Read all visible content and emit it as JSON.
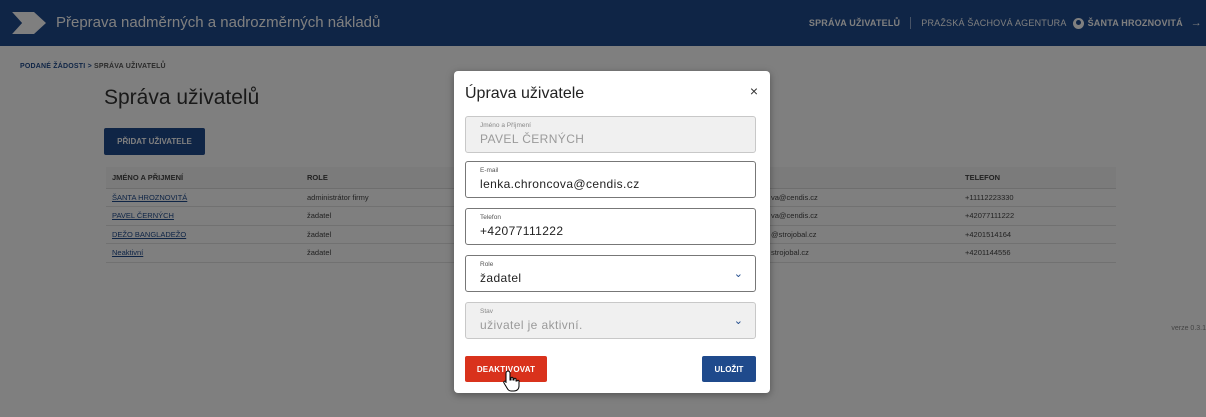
{
  "header": {
    "app_title": "Přeprava nadměrných a nadrozměrných nákladů",
    "nav_users": "SPRÁVA UŽIVATELŮ",
    "agency": "PRAŽSKÁ ŠACHOVÁ AGENTURA",
    "current_user": "ŠANTA HROZNOVITÁ",
    "logout_icon": "logout-icon",
    "user_icon": "user-circle-icon"
  },
  "breadcrumb": {
    "root": "PODANÉ ŽÁDOSTI",
    "separator": ">",
    "current": "SPRÁVA UŽIVATELŮ"
  },
  "page": {
    "title": "Správa uživatelů",
    "add_button": "PŘIDAT UŽIVATELE",
    "version": "verze 0.3.1"
  },
  "table": {
    "headers": [
      "JMÉNO A PŘIJMENÍ",
      "ROLE",
      "",
      "TELEFON"
    ],
    "rows": [
      {
        "name": "ŠANTA HROZNOVITÁ",
        "role": "administrátor firmy",
        "email": "va@cendis.cz",
        "phone": "+11112223330"
      },
      {
        "name": "PAVEL ČERNÝCH",
        "role": "žadatel",
        "email": "va@cendis.cz",
        "phone": "+42077111222"
      },
      {
        "name": "DEŽO BANGLADEŽO",
        "role": "žadatel",
        "email": "@strojobal.cz",
        "phone": "+4201514164"
      },
      {
        "name": "Neaktivní",
        "role": "žadatel",
        "email": "strojobal.cz",
        "phone": "+4201144556"
      }
    ]
  },
  "modal": {
    "title": "Úprava uživatele",
    "close_symbol": "×",
    "fields": {
      "name": {
        "label": "Jméno a Příjmení",
        "value": "PAVEL ČERNÝCH"
      },
      "email": {
        "label": "E-mail",
        "value": "lenka.chroncova@cendis.cz"
      },
      "phone": {
        "label": "Telefon",
        "value": "+42077111222"
      },
      "role": {
        "label": "Role",
        "value": "žadatel"
      },
      "stav": {
        "label": "Stav",
        "value": "uživatel je aktivní."
      }
    },
    "deactivate_button": "DEAKTIVOVAT",
    "save_button": "ULOŽIT"
  },
  "colors": {
    "brand": "#1f4a8c",
    "danger": "#d9321c"
  }
}
